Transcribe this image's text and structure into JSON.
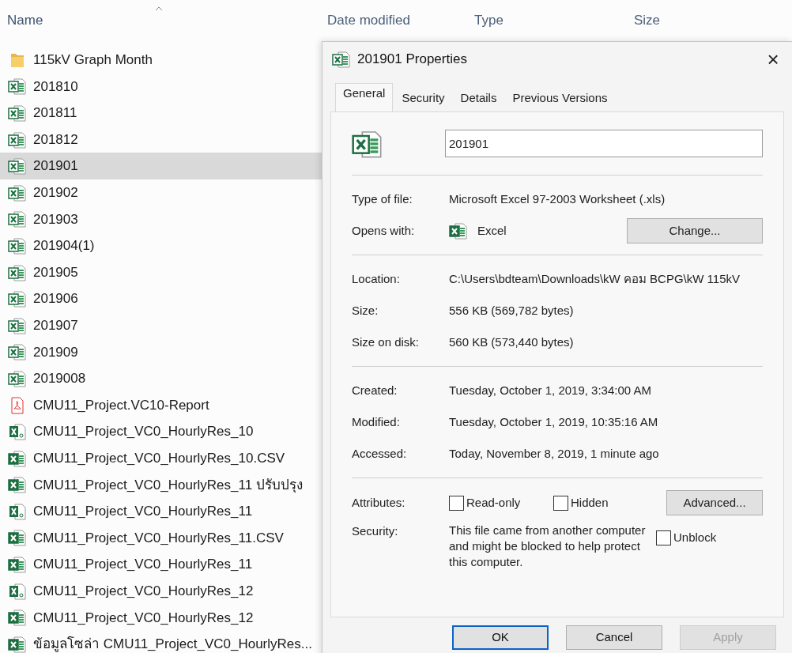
{
  "explorer": {
    "columns": [
      {
        "label": "Name",
        "sorted": true
      },
      {
        "label": "Date modified",
        "sorted": false
      },
      {
        "label": "Type",
        "sorted": false
      },
      {
        "label": "Size",
        "sorted": false
      }
    ],
    "files": [
      {
        "name": "115kV Graph Month",
        "kind": "folder",
        "selected": false
      },
      {
        "name": "201810",
        "kind": "xls",
        "selected": false
      },
      {
        "name": "201811",
        "kind": "xls",
        "selected": false
      },
      {
        "name": "201812",
        "kind": "xls",
        "selected": false
      },
      {
        "name": "201901",
        "kind": "xls",
        "selected": true
      },
      {
        "name": "201902",
        "kind": "xls",
        "selected": false
      },
      {
        "name": "201903",
        "kind": "xls",
        "selected": false
      },
      {
        "name": "201904(1)",
        "kind": "xls",
        "selected": false
      },
      {
        "name": "201905",
        "kind": "xls",
        "selected": false
      },
      {
        "name": "201906",
        "kind": "xls",
        "selected": false
      },
      {
        "name": "201907",
        "kind": "xls",
        "selected": false
      },
      {
        "name": "201909",
        "kind": "xls",
        "selected": false
      },
      {
        "name": "2019008",
        "kind": "xls",
        "selected": false
      },
      {
        "name": "CMU11_Project.VC10-Report",
        "kind": "pdf",
        "selected": false
      },
      {
        "name": "CMU11_Project_VC0_HourlyRes_10",
        "kind": "csv",
        "selected": false
      },
      {
        "name": "CMU11_Project_VC0_HourlyRes_10.CSV",
        "kind": "xlsx",
        "selected": false
      },
      {
        "name": "CMU11_Project_VC0_HourlyRes_11 ปรับปรุง",
        "kind": "xlsx",
        "selected": false
      },
      {
        "name": "CMU11_Project_VC0_HourlyRes_11",
        "kind": "csv",
        "selected": false
      },
      {
        "name": "CMU11_Project_VC0_HourlyRes_11.CSV",
        "kind": "xlsx",
        "selected": false
      },
      {
        "name": "CMU11_Project_VC0_HourlyRes_11",
        "kind": "xlsx",
        "selected": false
      },
      {
        "name": "CMU11_Project_VC0_HourlyRes_12",
        "kind": "csv",
        "selected": false
      },
      {
        "name": "CMU11_Project_VC0_HourlyRes_12",
        "kind": "xlsx",
        "selected": false
      },
      {
        "name": "ข้อมูลโซล่า CMU11_Project_VC0_HourlyRes...",
        "kind": "xlsx",
        "selected": false
      }
    ]
  },
  "dialog": {
    "title": "201901 Properties",
    "close": "×",
    "tabs": [
      {
        "label": "General",
        "selected": true
      },
      {
        "label": "Security",
        "selected": false
      },
      {
        "label": "Details",
        "selected": false
      },
      {
        "label": "Previous Versions",
        "selected": false
      }
    ],
    "file_name": "201901",
    "type_of_file": {
      "label": "Type of file:",
      "value": "Microsoft Excel 97-2003 Worksheet (.xls)"
    },
    "opens_with": {
      "label": "Opens with:",
      "app": "Excel",
      "button": "Change..."
    },
    "location": {
      "label": "Location:",
      "value": "C:\\Users\\bdteam\\Downloads\\kW คอม BCPG\\kW 115kV"
    },
    "size": {
      "label": "Size:",
      "value": "556 KB (569,782 bytes)"
    },
    "size_on_disk": {
      "label": "Size on disk:",
      "value": "560 KB (573,440 bytes)"
    },
    "created": {
      "label": "Created:",
      "value": "Tuesday, October 1, 2019, 3:34:00 AM"
    },
    "modified": {
      "label": "Modified:",
      "value": "Tuesday, October 1, 2019, 10:35:16 AM"
    },
    "accessed": {
      "label": "Accessed:",
      "value": "Today, November 8, 2019, 1 minute ago"
    },
    "attributes": {
      "label": "Attributes:",
      "read_only": {
        "label": "Read-only",
        "checked": false
      },
      "hidden": {
        "label": "Hidden",
        "checked": false
      },
      "button": "Advanced..."
    },
    "security": {
      "label": "Security:",
      "text": "This file came from another computer and might be blocked to help protect this computer.",
      "unblock": {
        "label": "Unblock",
        "checked": false
      }
    },
    "buttons": [
      {
        "label": "OK",
        "kind": "default",
        "disabled": false
      },
      {
        "label": "Cancel",
        "kind": "normal",
        "disabled": false
      },
      {
        "label": "Apply",
        "kind": "normal",
        "disabled": true
      }
    ]
  }
}
